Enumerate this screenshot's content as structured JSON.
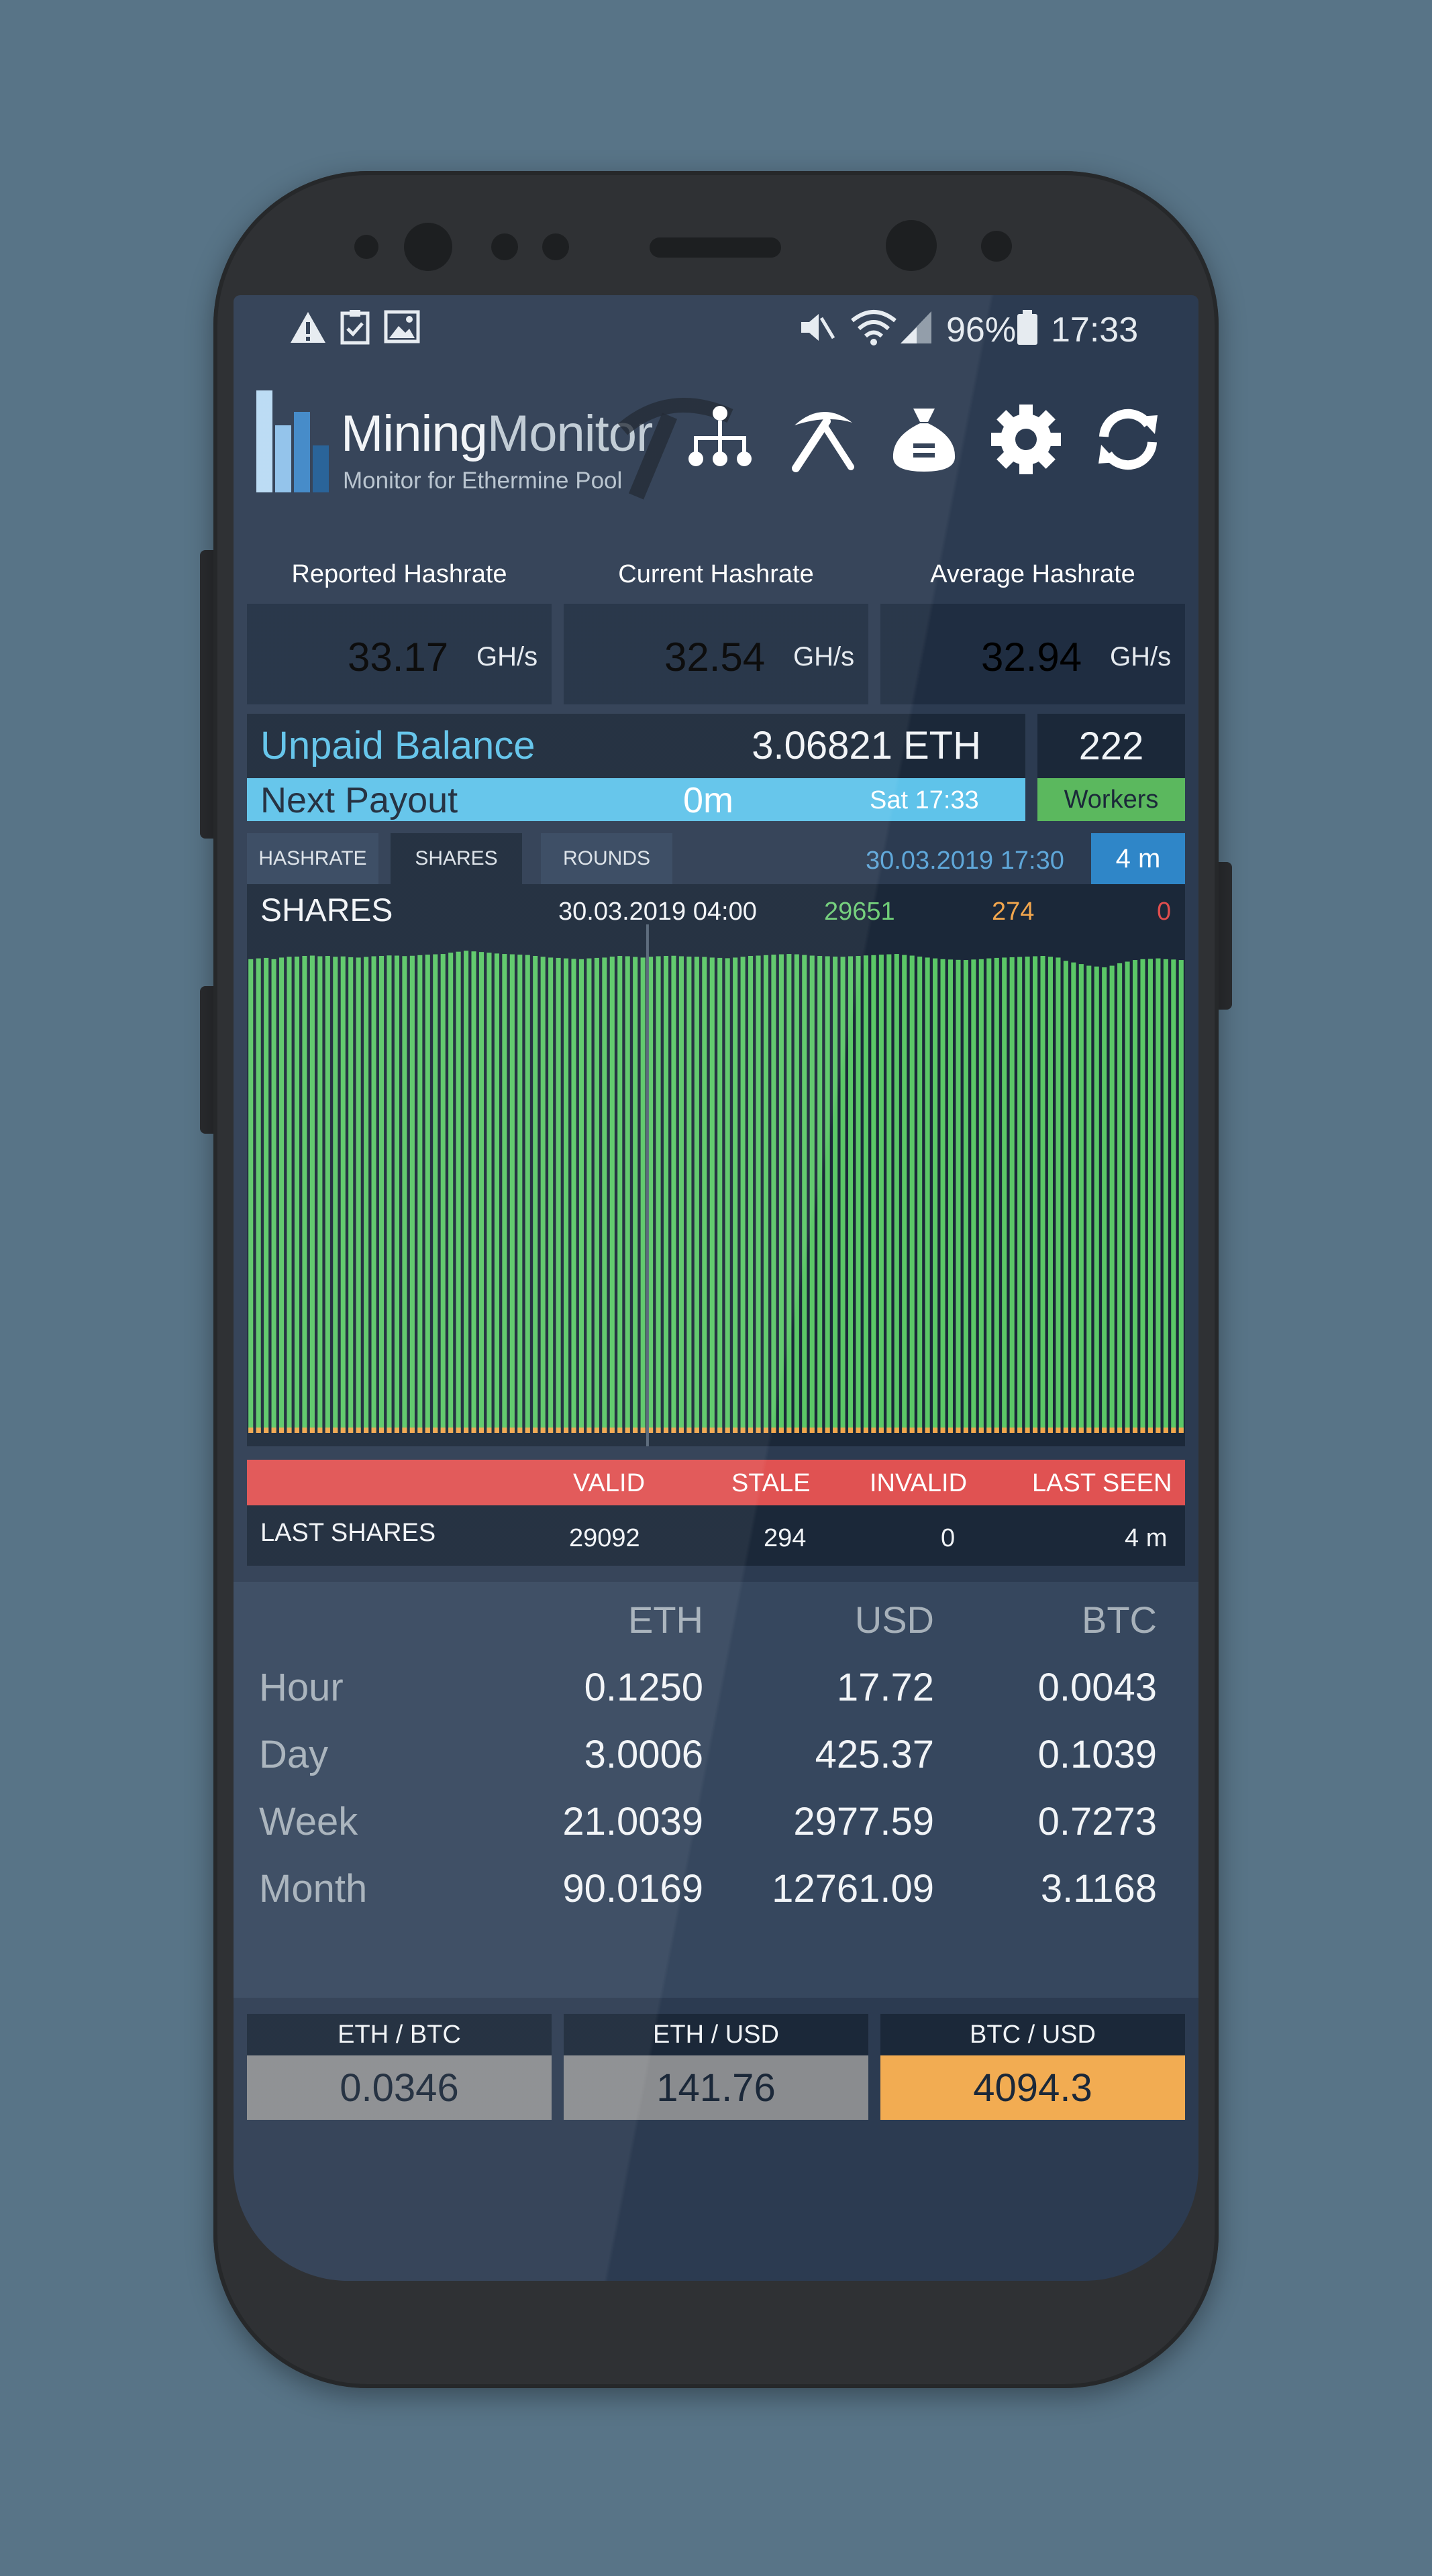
{
  "status_bar": {
    "battery": "96%",
    "time": "17:33"
  },
  "app": {
    "title_part1": "Mining",
    "title_part2": "Monitor",
    "subtitle": "Monitor for Ethermine Pool"
  },
  "hashrate_cards": [
    {
      "label": "Reported Hashrate",
      "value": "33.17",
      "unit": "GH/s",
      "color": "#2fa33f"
    },
    {
      "label": "Current Hashrate",
      "value": "32.54",
      "unit": "GH/s",
      "color": "#2f86c8"
    },
    {
      "label": "Average Hashrate",
      "value": "32.94",
      "unit": "GH/s",
      "color": "#f57f20"
    }
  ],
  "balance": {
    "unpaid_label": "Unpaid Balance",
    "unpaid_value": "3.06821 ETH",
    "next_payout_label": "Next Payout",
    "next_payout_value": "0m",
    "next_payout_time": "Sat 17:33",
    "workers_count": "222",
    "workers_label": "Workers"
  },
  "tabs": [
    "HASHRATE",
    "SHARES",
    "ROUNDS"
  ],
  "active_tab": "SHARES",
  "chart_header": {
    "timestamp": "30.03.2019 17:30",
    "interval": "4 m",
    "title": "SHARES",
    "cursor_time": "30.03.2019 04:00",
    "cursor_valid": "29651",
    "cursor_stale": "274",
    "cursor_invalid": "0"
  },
  "chart_data": {
    "type": "bar",
    "title": "SHARES",
    "series": [
      {
        "color": "#5bc767",
        "values": [
          29100,
          29150,
          29180,
          29100,
          29200,
          29250,
          29260,
          29300,
          29320,
          29280,
          29300,
          29250,
          29270,
          29220,
          29200,
          29240,
          29280,
          29300,
          29330,
          29320,
          29290,
          29310,
          29350,
          29380,
          29400,
          29420,
          29500,
          29560,
          29620,
          29580,
          29540,
          29500,
          29450,
          29420,
          29400,
          29380,
          29360,
          29300,
          29250,
          29200,
          29180,
          29150,
          29120,
          29100,
          29150,
          29180,
          29200,
          29260,
          29300,
          29280,
          29240,
          29200,
          29250,
          29280,
          29300,
          29310,
          29280,
          29260,
          29250,
          29240,
          29200,
          29180,
          29160,
          29200,
          29250,
          29300,
          29320,
          29350,
          29380,
          29400,
          29420,
          29400,
          29360,
          29320,
          29300,
          29280,
          29260,
          29250,
          29280,
          29300,
          29330,
          29350,
          29380,
          29400,
          29420,
          29360,
          29320,
          29260,
          29200,
          29150,
          29100,
          29080,
          29060,
          29050,
          29080,
          29100,
          29150,
          29180,
          29200,
          29220,
          29240,
          29260,
          29280,
          29300,
          29250,
          29200,
          29000,
          28900,
          28800,
          28700,
          28650,
          28600,
          28700,
          28850,
          28950,
          29050,
          29100,
          29120,
          29150,
          29100,
          29080,
          29050
        ]
      },
      {
        "color": "#f2a64d",
        "values": [
          274,
          274,
          274,
          274,
          274,
          274,
          274,
          274,
          274,
          274,
          274,
          274,
          274,
          274,
          274,
          274,
          274,
          274,
          274,
          274,
          274,
          274,
          274,
          274,
          274,
          274,
          274,
          274,
          274,
          274,
          274,
          274,
          274,
          274,
          274,
          274,
          274,
          274,
          274,
          274,
          274,
          274,
          274,
          274,
          274,
          274,
          274,
          274,
          274,
          274,
          274,
          274,
          274,
          274,
          274,
          274,
          274,
          274,
          274,
          274,
          274,
          274,
          274,
          274,
          274,
          274,
          274,
          274,
          274,
          274,
          274,
          274,
          274,
          274,
          274,
          274,
          274,
          274,
          274,
          274,
          274,
          274,
          274,
          274,
          274,
          274,
          274,
          274,
          274,
          274,
          274,
          274,
          274,
          274,
          274,
          274,
          274,
          274,
          274,
          274,
          274,
          274,
          274,
          274,
          274,
          274,
          274,
          274,
          274,
          274,
          274,
          274,
          274,
          274,
          274,
          274,
          274,
          274,
          274,
          274,
          274,
          274
        ]
      }
    ],
    "ylim": [
      0,
      30000
    ]
  },
  "shares_table": {
    "headers": [
      "VALID",
      "STALE",
      "INVALID",
      "LAST SEEN"
    ],
    "row_label": "LAST SHARES",
    "values": [
      "29092",
      "294",
      "0",
      "4 m"
    ]
  },
  "earnings": {
    "columns": [
      "ETH",
      "USD",
      "BTC"
    ],
    "rows": [
      {
        "label": "Hour",
        "eth": "0.1250",
        "usd": "17.72",
        "btc": "0.0043"
      },
      {
        "label": "Day",
        "eth": "3.0006",
        "usd": "425.37",
        "btc": "0.1039"
      },
      {
        "label": "Week",
        "eth": "21.0039",
        "usd": "2977.59",
        "btc": "0.7273"
      },
      {
        "label": "Month",
        "eth": "90.0169",
        "usd": "12761.09",
        "btc": "3.1168"
      }
    ]
  },
  "prices": [
    {
      "pair": "ETH / BTC",
      "value": "0.0346"
    },
    {
      "pair": "ETH / USD",
      "value": "141.76"
    },
    {
      "pair": "BTC / USD",
      "value": "4094.3"
    }
  ],
  "colors": {
    "green": "#2fa33f",
    "blue": "#2f86c8",
    "orange": "#f57f20",
    "light_blue": "#5fc3ea",
    "red": "#e04e4e",
    "price_highlight": "#f2ac52"
  }
}
